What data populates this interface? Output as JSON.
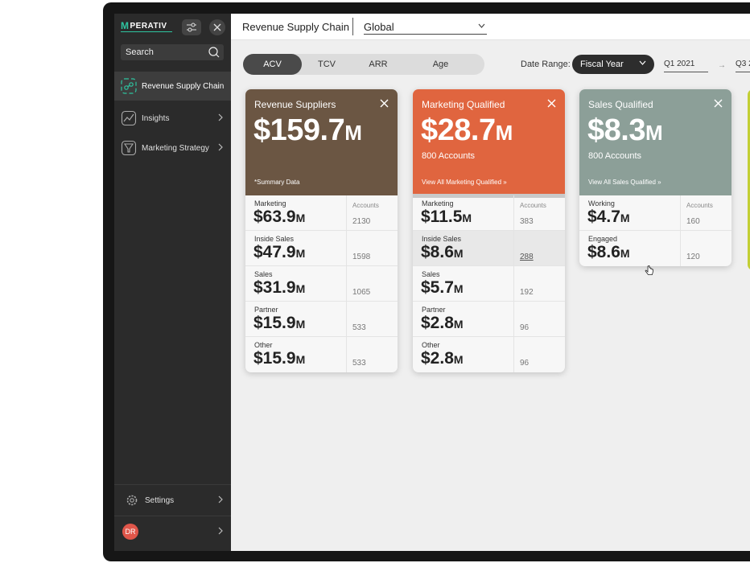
{
  "sidebar": {
    "logo": "PERATIV",
    "logo_mark": "M",
    "search_placeholder": "Search",
    "items": [
      {
        "label": "Revenue Supply Chain"
      },
      {
        "label": "Insights"
      },
      {
        "label": "Marketing Strategy"
      }
    ],
    "settings_label": "Settings",
    "avatar_initials": "DR"
  },
  "header": {
    "title": "Revenue Supply Chain",
    "region": "Global"
  },
  "tabs": [
    "ACV",
    "TCV",
    "ARR",
    "Age"
  ],
  "date_range": {
    "label": "Date Range:",
    "period": "Fiscal Year",
    "from": "Q1 2021",
    "arrow": "→",
    "to": "Q3 2"
  },
  "cards": [
    {
      "title": "Revenue Suppliers",
      "value": "$159.7",
      "unit": "M",
      "accounts": "",
      "footer": "*Summary Data",
      "color": "#6b5643",
      "rows": [
        {
          "segment": "Marketing",
          "value": "$63.9",
          "unit": "M",
          "accounts_header": "Accounts",
          "accounts": "2130"
        },
        {
          "segment": "Inside Sales",
          "value": "$47.9",
          "unit": "M",
          "accounts_header": "",
          "accounts": "1598"
        },
        {
          "segment": "Sales",
          "value": "$31.9",
          "unit": "M",
          "accounts_header": "",
          "accounts": "1065"
        },
        {
          "segment": "Partner",
          "value": "$15.9",
          "unit": "M",
          "accounts_header": "",
          "accounts": "533"
        },
        {
          "segment": "Other",
          "value": "$15.9",
          "unit": "M",
          "accounts_header": "",
          "accounts": "533"
        }
      ]
    },
    {
      "title": "Marketing Qualified",
      "value": "$28.7",
      "unit": "M",
      "accounts": "800 Accounts",
      "footer": "View All Marketing Qualified  »",
      "color": "#e0653f",
      "rows": [
        {
          "segment": "Marketing",
          "value": "$11.5",
          "unit": "M",
          "accounts_header": "Accounts",
          "accounts": "383"
        },
        {
          "segment": "Inside Sales",
          "value": "$8.6",
          "unit": "M",
          "accounts_header": "",
          "accounts": "288"
        },
        {
          "segment": "Sales",
          "value": "$5.7",
          "unit": "M",
          "accounts_header": "",
          "accounts": "192"
        },
        {
          "segment": "Partner",
          "value": "$2.8",
          "unit": "M",
          "accounts_header": "",
          "accounts": "96"
        },
        {
          "segment": "Other",
          "value": "$2.8",
          "unit": "M",
          "accounts_header": "",
          "accounts": "96"
        }
      ]
    },
    {
      "title": "Sales Qualified",
      "value": "$8.3",
      "unit": "M",
      "accounts": "800 Accounts",
      "footer": "View All Sales Qualified  »",
      "color": "#8c9f98",
      "rows": [
        {
          "segment": "Working",
          "value": "$4.7",
          "unit": "M",
          "accounts_header": "Accounts",
          "accounts": "160"
        },
        {
          "segment": "Engaged",
          "value": "$8.6",
          "unit": "M",
          "accounts_header": "",
          "accounts": "120"
        }
      ]
    }
  ]
}
